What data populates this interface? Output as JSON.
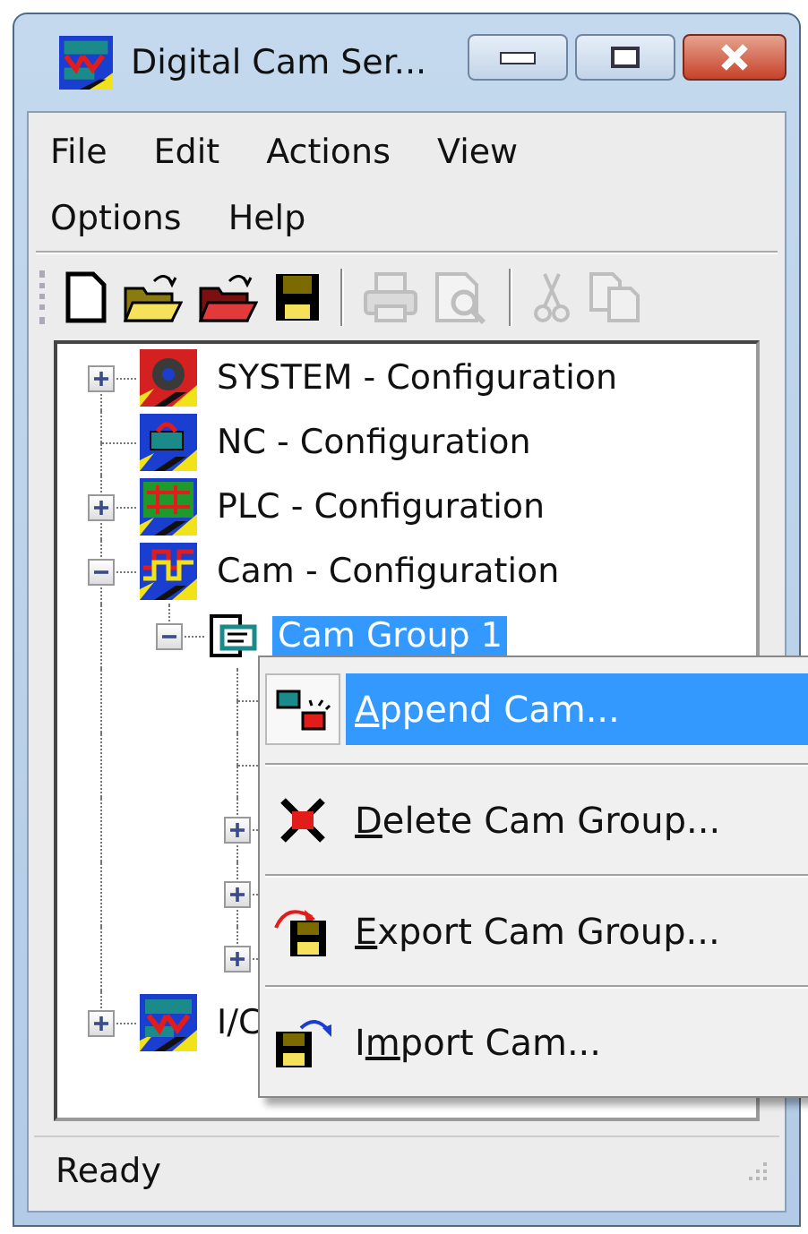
{
  "window": {
    "title": "Digital Cam Ser..."
  },
  "menu_bar": [
    "File",
    "Edit",
    "Actions",
    "View",
    "Options",
    "Help"
  ],
  "toolbar": [
    {
      "kind": "new",
      "disabled": false
    },
    {
      "kind": "open",
      "disabled": false
    },
    {
      "kind": "open-red",
      "disabled": false
    },
    {
      "kind": "save",
      "disabled": false
    },
    {
      "kind": "separator"
    },
    {
      "kind": "print",
      "disabled": true
    },
    {
      "kind": "preview",
      "disabled": true
    },
    {
      "kind": "separator"
    },
    {
      "kind": "cut",
      "disabled": true
    },
    {
      "kind": "copy",
      "disabled": true
    }
  ],
  "tree": [
    {
      "label": "SYSTEM - Configuration",
      "kind": "system",
      "expandable": true,
      "expanded": false,
      "selected": false
    },
    {
      "label": "NC - Configuration",
      "kind": "nc",
      "expandable": false,
      "selected": false
    },
    {
      "label": "PLC - Configuration",
      "kind": "plc",
      "expandable": true,
      "expanded": false,
      "selected": false
    },
    {
      "label": "Cam - Configuration",
      "kind": "cam",
      "expandable": true,
      "expanded": true,
      "selected": false,
      "children": [
        {
          "label": "Cam Group 1",
          "kind": "group",
          "expandable": true,
          "expanded": true,
          "selected": true,
          "children": [
            {
              "expandable": false
            },
            {
              "expandable": false
            },
            {
              "expandable": true,
              "expanded": false
            },
            {
              "expandable": true,
              "expanded": false
            },
            {
              "expandable": true,
              "expanded": false
            }
          ]
        }
      ]
    },
    {
      "label": "I/C",
      "kind": "io",
      "expandable": true,
      "expanded": false,
      "selected": false
    }
  ],
  "context_menu": [
    {
      "kind": "append",
      "key": "A",
      "after": "ppend Cam...",
      "selected": true
    },
    {
      "kind": "delete",
      "key": "D",
      "after": "elete Cam Group...",
      "selected": false
    },
    {
      "kind": "export",
      "key": "E",
      "after": "xport Cam Group...",
      "selected": false
    },
    {
      "kind": "import",
      "before": "I",
      "key": "m",
      "after": "port Cam...",
      "selected": false
    }
  ],
  "status_bar": {
    "text": "Ready"
  }
}
